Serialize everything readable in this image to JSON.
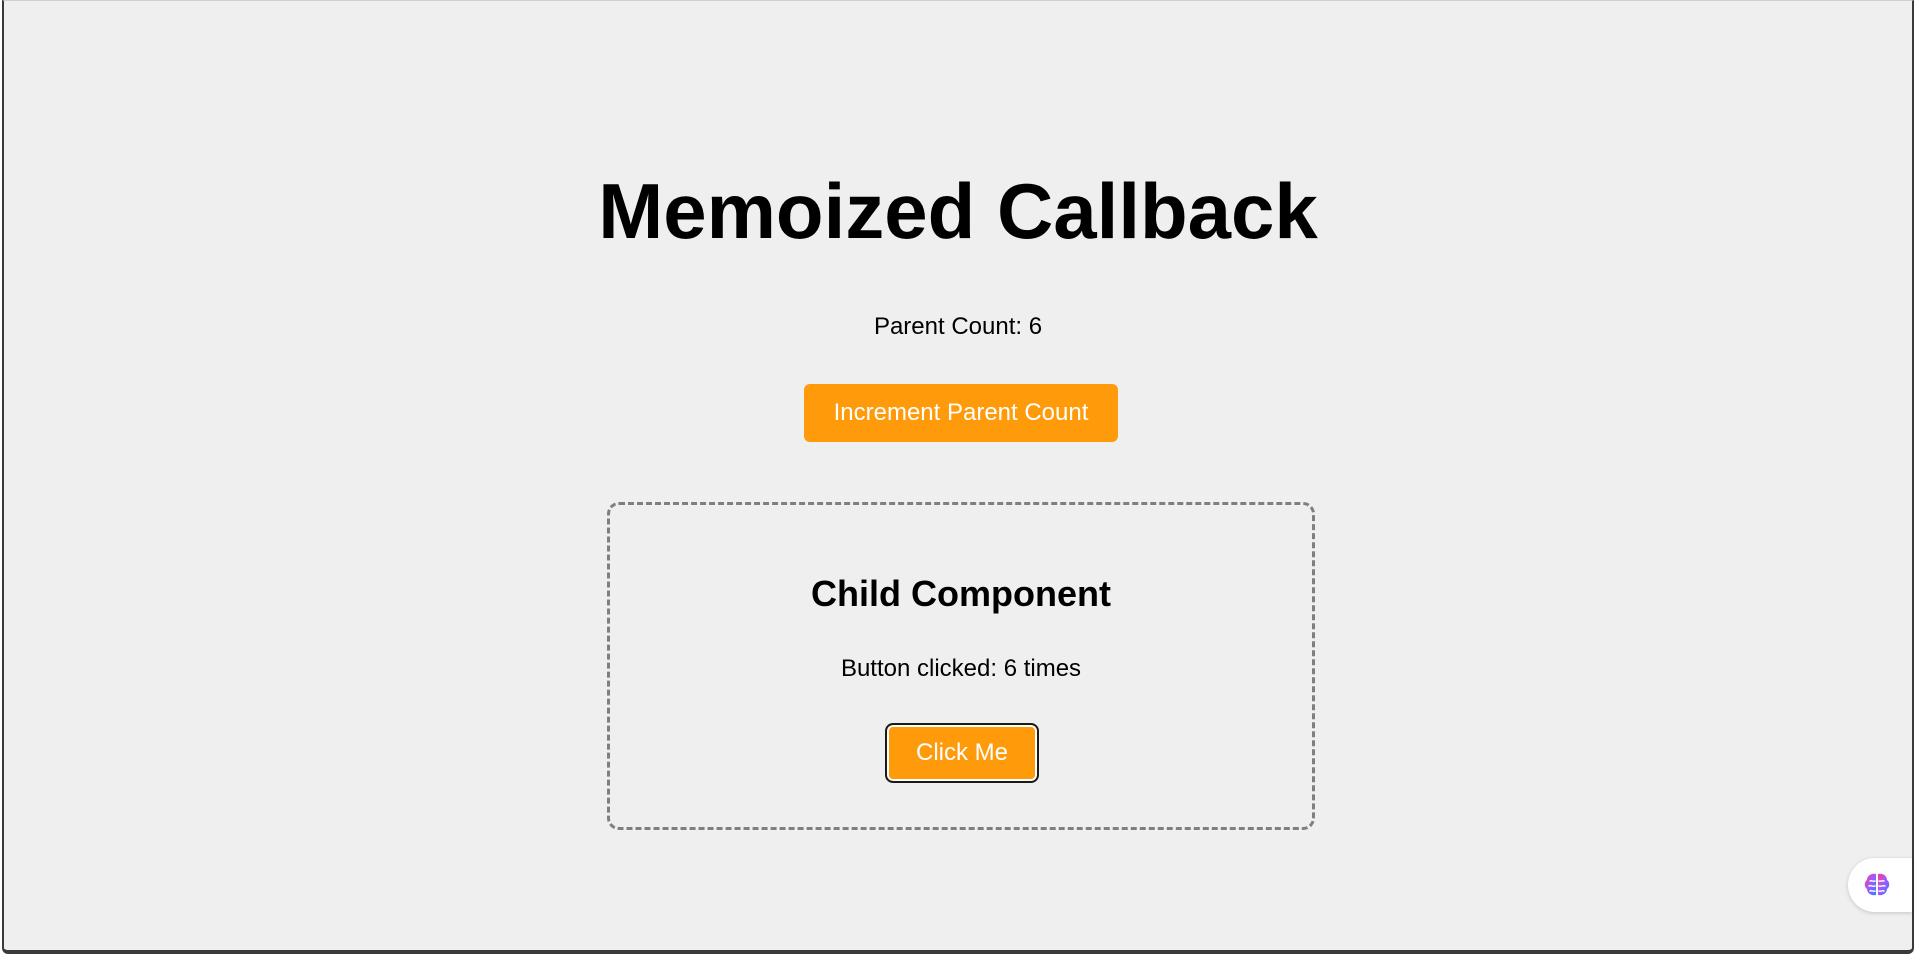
{
  "main": {
    "title": "Memoized Callback",
    "parent_count_text": "Parent Count: 6",
    "increment_button_label": "Increment Parent Count"
  },
  "child": {
    "title": "Child Component",
    "clicked_text": "Button clicked: 6 times",
    "click_button_label": "Click Me"
  },
  "extension": {
    "icon": "brain-icon"
  },
  "colors": {
    "accent": "#ff9a0a",
    "background": "#efefef",
    "dashed_border": "#7f7f7f"
  }
}
